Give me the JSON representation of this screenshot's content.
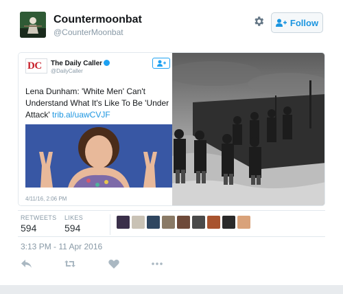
{
  "user": {
    "display_name": "Countermoonbat",
    "handle": "@CounterMoonbat",
    "avatar_icon": "avatar-image"
  },
  "header": {
    "settings_icon": "gear-icon",
    "follow_label": "Follow",
    "follow_icon": "add-user-icon"
  },
  "embedded_card": {
    "source_name": "The Daily Caller",
    "source_handle": "@DailyCaller",
    "logo_text": "DC",
    "headline": "Lena Dunham: 'White Men' Can't Understand What It's Like To Be 'Under Attack'",
    "link": "trib.al/uawCVJF",
    "date": "4/11/16, 2:06 PM"
  },
  "stats": {
    "retweets_label": "RETWEETS",
    "retweets_value": "594",
    "likes_label": "LIKES",
    "likes_value": "594",
    "liker_avatar_count": 9
  },
  "timestamp": "3:13 PM - 11 Apr 2016",
  "actions": [
    "reply-icon",
    "retweet-icon",
    "like-icon",
    "more-icon"
  ],
  "colors": {
    "link": "#1b95e0",
    "muted": "#8899a6",
    "border": "#e1e8ed",
    "dc_red": "#c8202a"
  }
}
